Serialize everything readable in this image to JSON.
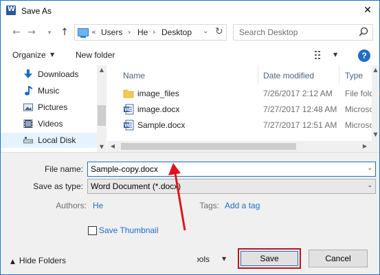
{
  "window": {
    "title": "Save As",
    "icon": "word-icon"
  },
  "nav": {
    "address_segments": [
      "Users",
      "He",
      "Desktop"
    ],
    "address_prefix": "«",
    "search_placeholder": "Search Desktop"
  },
  "toolbar": {
    "organize_label": "Organize",
    "new_folder_label": "New folder",
    "help_label": "?"
  },
  "sidebar": {
    "items": [
      {
        "label": "Downloads",
        "icon": "download-icon"
      },
      {
        "label": "Music",
        "icon": "music-icon"
      },
      {
        "label": "Pictures",
        "icon": "pictures-icon"
      },
      {
        "label": "Videos",
        "icon": "videos-icon"
      },
      {
        "label": "Local Disk",
        "icon": "drive-icon",
        "selected": true
      }
    ]
  },
  "files": {
    "columns": [
      "Name",
      "Date modified",
      "Type"
    ],
    "rows": [
      {
        "name": "image_files",
        "date": "7/26/2017 2:12 AM",
        "type": "File folder",
        "icon": "folder-icon"
      },
      {
        "name": "image.docx",
        "date": "7/27/2017 12:48 AM",
        "type": "Microsoft",
        "icon": "word-doc-icon"
      },
      {
        "name": "Sample.docx",
        "date": "7/27/2017 12:51 AM",
        "type": "Microsoft",
        "icon": "word-doc-icon"
      }
    ]
  },
  "form": {
    "file_name_label": "File name:",
    "file_name_value": "Sample-copy.docx",
    "save_type_label": "Save as type:",
    "save_type_value": "Word Document (*.docx)",
    "authors_label": "Authors:",
    "authors_value": "He",
    "tags_label": "Tags:",
    "tags_value": "Add a tag",
    "thumbnail_label": "Save Thumbnail",
    "thumbnail_checked": false
  },
  "footer": {
    "hide_folders_label": "Hide Folders",
    "tools_label": "Tools",
    "save_label": "Save",
    "cancel_label": "Cancel"
  },
  "colors": {
    "accent": "#1f6dc4",
    "highlight_box": "#b5171f",
    "annotation_arrow": "#e0141e"
  }
}
